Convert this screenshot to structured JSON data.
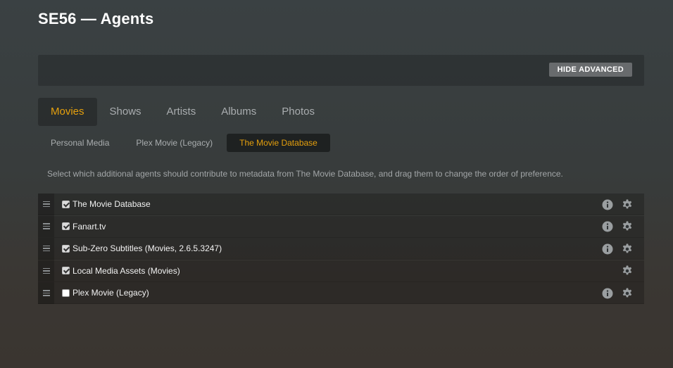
{
  "page": {
    "title": "SE56 — Agents"
  },
  "toolbar": {
    "hide_advanced_label": "HIDE ADVANCED"
  },
  "type_tabs": [
    {
      "label": "Movies",
      "active": true
    },
    {
      "label": "Shows",
      "active": false
    },
    {
      "label": "Artists",
      "active": false
    },
    {
      "label": "Albums",
      "active": false
    },
    {
      "label": "Photos",
      "active": false
    }
  ],
  "agent_tabs": [
    {
      "label": "Personal Media",
      "active": false
    },
    {
      "label": "Plex Movie (Legacy)",
      "active": false
    },
    {
      "label": "The Movie Database",
      "active": true
    }
  ],
  "description": "Select which additional agents should contribute to metadata from The Movie Database, and drag them to change the order of preference.",
  "agents": [
    {
      "name": "The Movie Database",
      "checked": true,
      "has_info": true,
      "icons": [
        "info-icon",
        "gear-icon"
      ]
    },
    {
      "name": "Fanart.tv",
      "checked": true,
      "has_info": true,
      "icons": [
        "info-icon",
        "gear-icon"
      ]
    },
    {
      "name": "Sub-Zero Subtitles (Movies, 2.6.5.3247)",
      "checked": true,
      "has_info": true,
      "icons": [
        "info-icon",
        "gear-icon"
      ]
    },
    {
      "name": "Local Media Assets (Movies)",
      "checked": true,
      "has_info": false,
      "icons": [
        "gear-icon"
      ]
    },
    {
      "name": "Plex Movie (Legacy)",
      "checked": false,
      "has_info": true,
      "icons": [
        "info-icon",
        "gear-icon"
      ]
    }
  ],
  "colors": {
    "accent": "#e5a00d",
    "button_bg": "#686b6d",
    "text_muted": "#a9adaf"
  }
}
